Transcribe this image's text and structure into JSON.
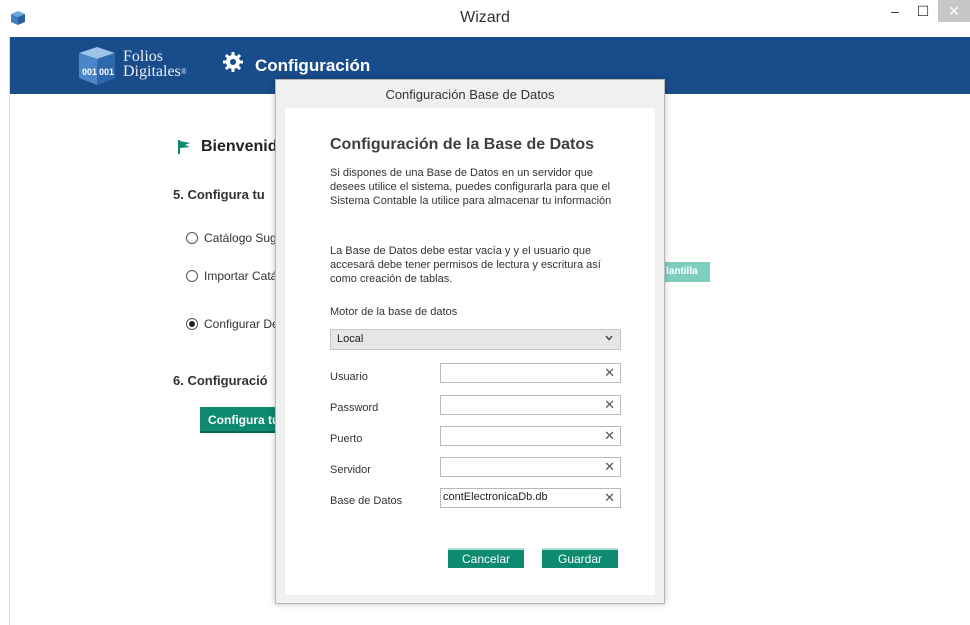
{
  "window": {
    "title": "Wizard",
    "minimize": "–",
    "maximize": "☐",
    "close": "✕"
  },
  "header": {
    "logo_line1": "Folios",
    "logo_line2": "Digitales",
    "logo_mark": "®",
    "title": "Configuración",
    "color": "#184c8a"
  },
  "background": {
    "welcome": "Bienvenid",
    "step5": "5. Configura tu",
    "options": [
      {
        "label": "Catálogo Sug",
        "checked": false
      },
      {
        "label": "Importar Catá",
        "checked": false
      },
      {
        "label": "Configurar De",
        "checked": true
      }
    ],
    "step6": "6. Configuració",
    "configure_button": "Configura tu",
    "plantilla_button": "lantilla"
  },
  "dialog": {
    "window_title": "Configuración Base de Datos",
    "heading": "Configuración de la Base de Datos",
    "paragraph1": "Si dispones de una Base de Datos en un servidor que desees utilice el sistema, puedes configurarla para que el Sistema Contable la utilice para almacenar tu información",
    "paragraph2": "La Base de Datos debe estar vacía y y el usuario que accesará debe tener permisos de lectura y escritura así como creación de tablas.",
    "engine_label": "Motor de la base de datos",
    "engine_value": "Local",
    "fields": [
      {
        "label": "Usuario",
        "value": ""
      },
      {
        "label": "Password",
        "value": ""
      },
      {
        "label": "Puerto",
        "value": ""
      },
      {
        "label": "Servidor",
        "value": ""
      },
      {
        "label": "Base de Datos",
        "value": "contElectronicaDb.db"
      }
    ],
    "clear_icon": "✕",
    "cancel_label": "Cancelar",
    "save_label": "Guardar",
    "accent": "#0d8a6f"
  }
}
